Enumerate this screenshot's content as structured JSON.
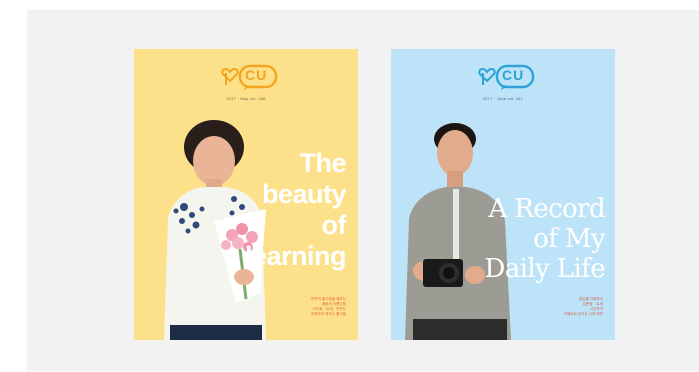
{
  "covers": [
    {
      "id": "learning",
      "background": "#fde08a",
      "logo_text": "CU",
      "issue_line": "2017 · May vol. 180",
      "headline": [
        "The",
        "beauty",
        "of",
        "learning"
      ],
      "bottom_text": [
        "만학의 즐거움을 배우다",
        "배움의 아름다움",
        "이주희 · 61세 · 만학도",
        "하루하루 배우는 즐거움"
      ]
    },
    {
      "id": "daily-life",
      "background": "#bde3f8",
      "logo_text": "CU",
      "issue_line": "2017 · June vol. 181",
      "headline": [
        "A Record",
        "of My",
        "Daily Life"
      ],
      "bottom_text": [
        "일상을 기록하다",
        "김준영 · 31세",
        "사진작가",
        "카메라로 남기는 나의 하루"
      ]
    }
  ],
  "colors": {
    "panel": "#f2f2f2",
    "yellow_logo": "#f2a51f",
    "blue_logo": "#2ea3d8"
  }
}
